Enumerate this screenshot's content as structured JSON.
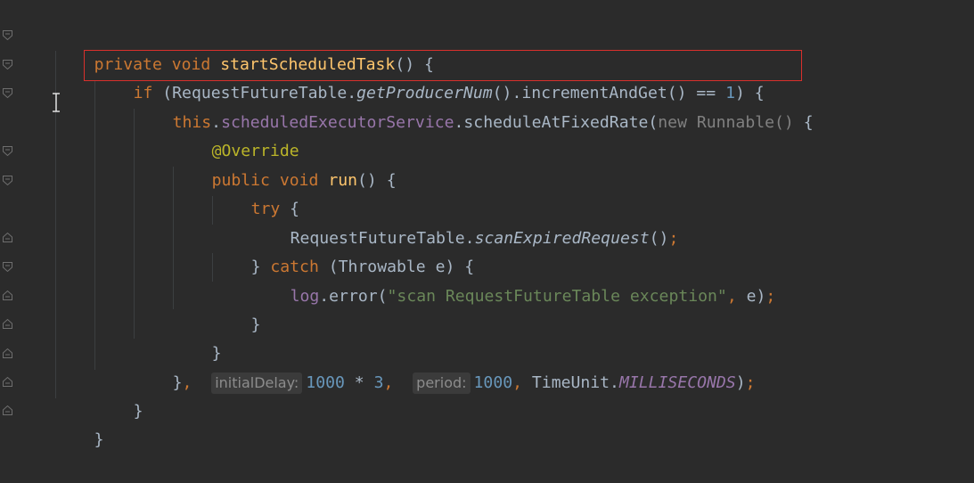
{
  "code": {
    "line1": {
      "kw1": "private",
      "kw2": "void",
      "name": "startScheduledTask",
      "rest": "() {"
    },
    "line2": {
      "kw": "if",
      "open": " (RequestFutureTable.",
      "method": "getProducerNum",
      "mid": "().incrementAndGet() == ",
      "num": "1",
      "close": ") {"
    },
    "line3": {
      "kw": "this",
      "dot": ".",
      "field": "scheduledExecutorService",
      "call": ".scheduleAtFixedRate(",
      "new_runnable": "new Runnable()",
      "brace": " {"
    },
    "line4": {
      "annotation": "@Override"
    },
    "line5": {
      "kw1": "public",
      "kw2": "void",
      "name": "run",
      "rest": "() {"
    },
    "line6": {
      "kw": "try",
      "rest": " {"
    },
    "line7": {
      "cls": "RequestFutureTable.",
      "method": "scanExpiredRequest",
      "rest": "()",
      "semi": ";"
    },
    "line8": {
      "close": "} ",
      "kw": "catch",
      "rest": " (Throwable e) {"
    },
    "line9": {
      "field": "log",
      "call": ".error(",
      "str": "\"scan RequestFutureTable exception\"",
      "comma": ",",
      "rest": " e)",
      "semi": ";"
    },
    "line10": {
      "text": "}"
    },
    "line11": {
      "text": "}"
    },
    "line12": {
      "close": "}",
      "comma1": ",",
      "hint1": "initialDelay:",
      "num1": "1000",
      "op": " * ",
      "num2": "3",
      "comma2": ",",
      "hint2": "period:",
      "num3": "1000",
      "comma3": ",",
      "cls": " TimeUnit.",
      "const": "MILLISECONDS",
      "end": ")",
      "semi": ";"
    },
    "line13": {
      "text": "}"
    },
    "line14": {
      "text": "}"
    }
  },
  "colors": {
    "background": "#2b2b2b",
    "keyword": "#cc7832",
    "function": "#ffc66d",
    "field": "#9876aa",
    "number": "#6897bb",
    "string": "#6a8759",
    "annotation": "#bbb529",
    "highlight_border": "#d9302c"
  },
  "icons": [
    "fold-open-icon",
    "fold-close-icon",
    "text-cursor-icon"
  ]
}
